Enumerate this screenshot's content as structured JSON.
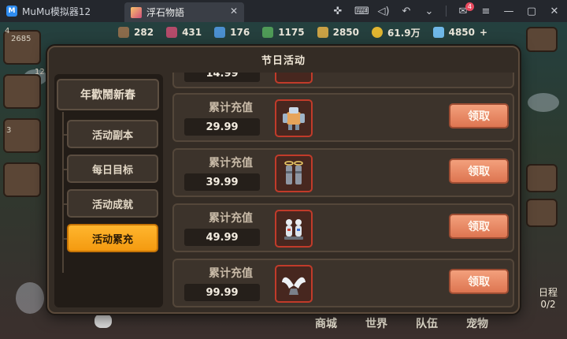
{
  "titlebar": {
    "app_name": "MuMu模拟器12",
    "game_tab": "浮石物語",
    "close_glyph": "✕",
    "mail_badge": "4"
  },
  "resources": [
    "282",
    "431",
    "176",
    "1175",
    "2850",
    "61.9万",
    "4850"
  ],
  "left_hud": {
    "level": "4",
    "num1": "2685",
    "num2": "12",
    "num3": "3"
  },
  "dialog": {
    "title": "节日活动",
    "main_category": "年歡鬧新春",
    "side_items": [
      {
        "label": "活动副本",
        "active": false
      },
      {
        "label": "每日目标",
        "active": false
      },
      {
        "label": "活动成就",
        "active": false
      },
      {
        "label": "活动累充",
        "active": true
      }
    ],
    "partial_row_amount": "14.99",
    "rows": [
      {
        "label": "累计充值",
        "amount": "29.99",
        "icon": "mech-robot-icon",
        "button": "领取"
      },
      {
        "label": "累计充值",
        "amount": "39.99",
        "icon": "twin-pillars-icon",
        "button": "领取"
      },
      {
        "label": "累计充值",
        "amount": "49.99",
        "icon": "white-figures-icon",
        "button": "领取"
      },
      {
        "label": "累计充值",
        "amount": "99.99",
        "icon": "angel-wings-icon",
        "button": "领取"
      }
    ]
  },
  "bottom_nav": [
    "商城",
    "世界",
    "队伍",
    "宠物"
  ],
  "schedule": {
    "label": "日程",
    "count": "0/2"
  }
}
